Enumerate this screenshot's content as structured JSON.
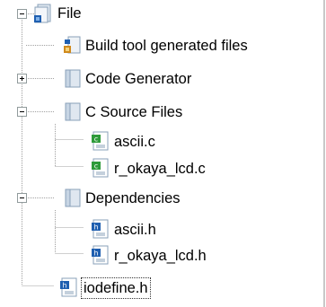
{
  "tree": {
    "root": {
      "label": "File",
      "icon": "project-icon"
    },
    "items": [
      {
        "label": "Build tool generated files",
        "icon": "build-files-icon"
      },
      {
        "label": "Code Generator",
        "icon": "folder-icon"
      },
      {
        "label": "C Source Files",
        "icon": "folder-icon"
      },
      {
        "label": "ascii.c",
        "icon": "c-file-icon"
      },
      {
        "label": "r_okaya_lcd.c",
        "icon": "c-file-icon"
      },
      {
        "label": "Dependencies",
        "icon": "folder-icon"
      },
      {
        "label": "ascii.h",
        "icon": "h-file-icon"
      },
      {
        "label": "r_okaya_lcd.h",
        "icon": "h-file-icon"
      },
      {
        "label": "iodefine.h",
        "icon": "h-file-icon",
        "focused": true
      }
    ]
  },
  "colors": {
    "folder": "#dfe7f0",
    "folder_edge": "#8aa0b8",
    "c_badge": "#2e9b3a",
    "h_badge": "#1f5fb0",
    "tree_line": "#a0a0a0"
  }
}
